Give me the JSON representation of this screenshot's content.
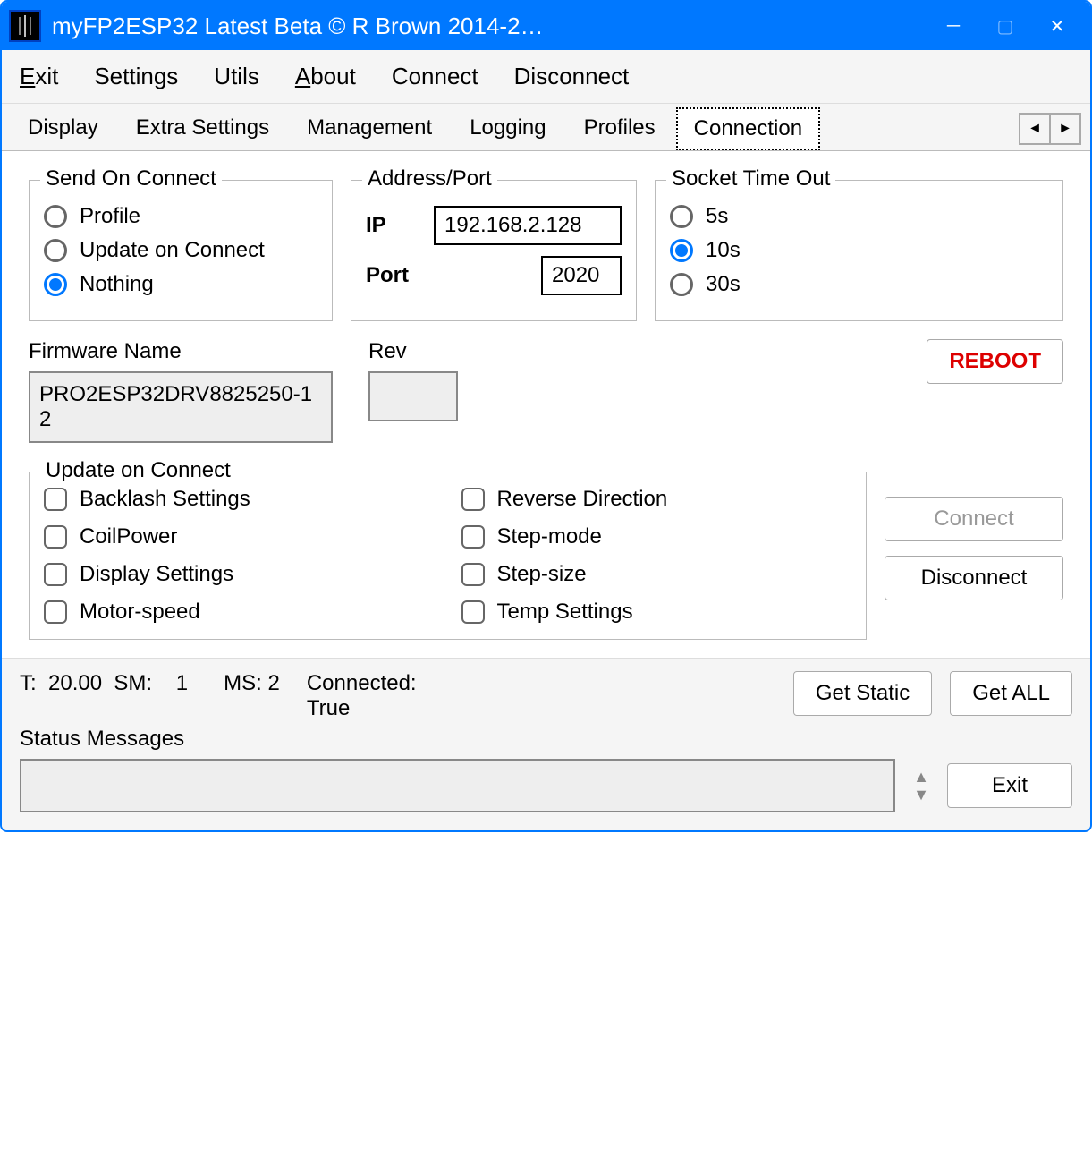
{
  "window": {
    "title": "myFP2ESP32 Latest Beta © R Brown 2014-2…"
  },
  "menubar": [
    "Exit",
    "Settings",
    "Utils",
    "About",
    "Connect",
    "Disconnect"
  ],
  "menubar_underline": [
    0,
    -1,
    -1,
    0,
    -1,
    -1
  ],
  "tabs": [
    "Display",
    "Extra Settings",
    "Management",
    "Logging",
    "Profiles",
    "Connection"
  ],
  "active_tab": "Connection",
  "send_on_connect": {
    "title": "Send On Connect",
    "options": [
      "Profile",
      "Update on Connect",
      "Nothing"
    ],
    "selected": "Nothing"
  },
  "address_port": {
    "title": "Address/Port",
    "ip_label": "IP",
    "ip_value": "192.168.2.128",
    "port_label": "Port",
    "port_value": "2020"
  },
  "socket_timeout": {
    "title": "Socket Time Out",
    "options": [
      "5s",
      "10s",
      "30s"
    ],
    "selected": "10s"
  },
  "firmware": {
    "label": "Firmware Name",
    "value": "PRO2ESP32DRV8825250-12",
    "rev_label": "Rev",
    "rev_value": ""
  },
  "buttons": {
    "reboot": "REBOOT",
    "connect": "Connect",
    "disconnect": "Disconnect",
    "get_static": "Get Static",
    "get_all": "Get ALL",
    "exit": "Exit"
  },
  "update_on_connect": {
    "title": "Update on Connect",
    "items_col1": [
      "Backlash Settings",
      "CoilPower",
      "Display Settings",
      "Motor-speed"
    ],
    "items_col2": [
      "Reverse Direction",
      "Step-mode",
      "Step-size",
      "Temp Settings"
    ]
  },
  "status": {
    "t_label": "T:",
    "t_value": "20.00",
    "sm_label": "SM:",
    "sm_value": "1",
    "ms_label": "MS:",
    "ms_value": "2",
    "connected_label": "Connected:",
    "connected_value": "True",
    "messages_label": "Status Messages",
    "messages_value": ""
  }
}
